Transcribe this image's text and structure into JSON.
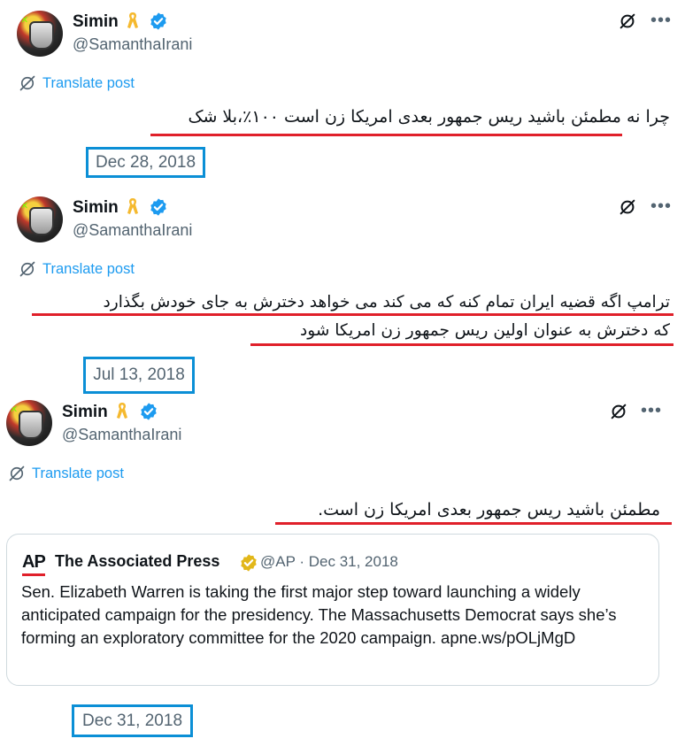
{
  "posts": [
    {
      "author_name": "Simin",
      "author_handle": "@SamanthaIrani",
      "translate_label": "Translate post",
      "text_lines": [
        "چرا نه مطمئن باشید ریس جمهور بعدی امریکا زن است ۱۰۰٪،بلا شک"
      ],
      "date": "Dec 28, 2018"
    },
    {
      "author_name": "Simin",
      "author_handle": "@SamanthaIrani",
      "translate_label": "Translate post",
      "text_lines": [
        "ترامپ اگه قضیه ایران تمام کنه که می کند می خواهد دخترش به جای خودش بگذارد",
        "که دخترش به عنوان اولین ریس جمهور زن امریکا شود"
      ],
      "date": "Jul 13, 2018"
    },
    {
      "author_name": "Simin",
      "author_handle": "@SamanthaIrani",
      "translate_label": "Translate post",
      "text_lines": [
        "مطمئن باشید ریس جمهور بعدی امریکا زن است."
      ],
      "date": "Dec 31, 2018"
    }
  ],
  "quote": {
    "logo_text": "AP",
    "name": "The Associated Press",
    "meta": "@AP · Dec 31, 2018",
    "text": "Sen. Elizabeth Warren is taking the first major step toward launching a widely anticipated campaign for the presidency. The Massachusetts Democrat says she’s forming an exploratory committee for the 2020 campaign. apne.ws/pOLjMgD"
  },
  "icons": {
    "ribbon": "yellow-ribbon-icon",
    "verified": "verified-badge-icon",
    "grok": "grok-icon",
    "more": "more-icon",
    "translate": "translate-icon"
  },
  "colors": {
    "verified": "#1d9bf0",
    "ribbon": "#f5b92e",
    "annotation_underline": "#e0202a",
    "annotation_box": "#0b8fd6",
    "link": "#1d9bf0",
    "gold_badge": "#e2b719"
  }
}
